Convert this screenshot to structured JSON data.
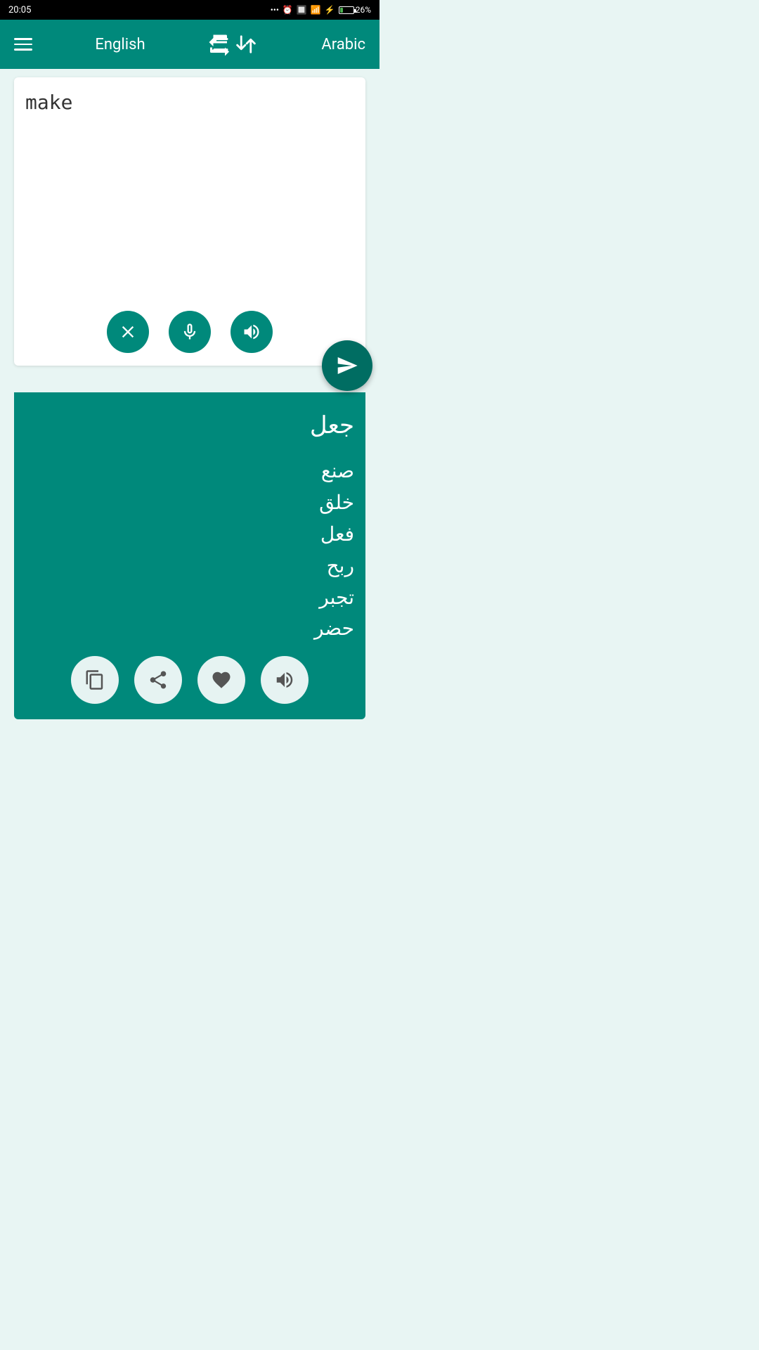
{
  "status": {
    "time": "20:05",
    "battery_pct": "26%"
  },
  "header": {
    "source_lang": "English",
    "target_lang": "Arabic",
    "menu_label": "menu",
    "swap_label": "swap languages"
  },
  "input": {
    "value": "make",
    "placeholder": ""
  },
  "buttons": {
    "clear_label": "clear",
    "mic_label": "microphone",
    "speaker_label": "speaker",
    "translate_label": "translate"
  },
  "output": {
    "lines": [
      "جعل",
      "صنع",
      "خلق",
      "فعل",
      "ربح",
      "تجبر",
      "حضر"
    ]
  },
  "output_buttons": {
    "copy_label": "copy",
    "share_label": "share",
    "favorite_label": "favorite",
    "audio_label": "audio"
  }
}
